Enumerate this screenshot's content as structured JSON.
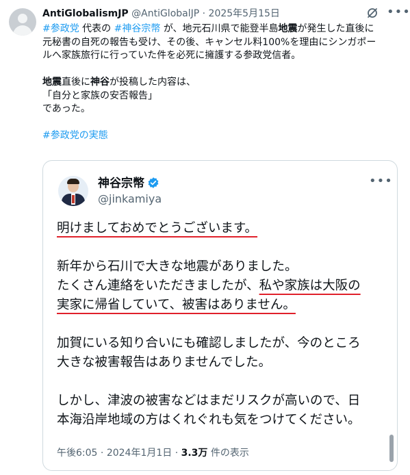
{
  "tweet": {
    "author_name": "AntiGlobalismJP",
    "author_handle": "@AntiGlobalJP",
    "separator": " · ",
    "date": "2025年5月15日",
    "lines": {
      "l1_tag1": "#参政党",
      "l1_t1": " 代表の ",
      "l1_tag2": "#神谷宗幣",
      "l1_t2": " が、地元石川県で能登半島",
      "l1_b1": "地震",
      "l1_t3": "が発生した直後に",
      "l2": "元秘書の自死の報告も受け、その後、キャンセル料100%を理由にシンガポー",
      "l3": "ルへ家族旅行に行っていた件を必死に擁護する参政党信者。",
      "l5_b1": "地震",
      "l5_t1": "直後に",
      "l5_b2": "神谷",
      "l5_t2": "が投稿した内容は、",
      "l6": "「自分と家族の安否報告」",
      "l7": "であった。",
      "tag_last": "#参政党の実態"
    }
  },
  "embedded": {
    "name": "神谷宗幣",
    "handle": "@jinkamiya",
    "p1": "明けましておめでとうございます。",
    "p2a": "新年から石川で大きな地震がありました。",
    "p2b_plain": "たくさん連絡をいただきましたが、",
    "p2b_ul": "私や家族は大阪の",
    "p2c_ul": "実家に帰省していて、被害はありません。",
    "p3a": "加賀にいる知り合いにも確認しましたが、今のところ",
    "p3b": "大きな被害報告はありませんでした。",
    "p4a": "しかし、津波の被害などはまだリスクが高いので、日",
    "p4b": "本海沿岸地域の方はくれぐれも気をつけてください。",
    "time": "午後6:05",
    "sep": " · ",
    "date": "2024年1月1日",
    "views": "3.3万",
    "views_suffix": " 件の表示"
  },
  "colors": {
    "link": "#1d9bf0",
    "underline": "#e0202a",
    "verified": "#1d9bf0"
  },
  "icons": [
    "avatar",
    "grok-icon",
    "more-icon",
    "verified-icon"
  ]
}
